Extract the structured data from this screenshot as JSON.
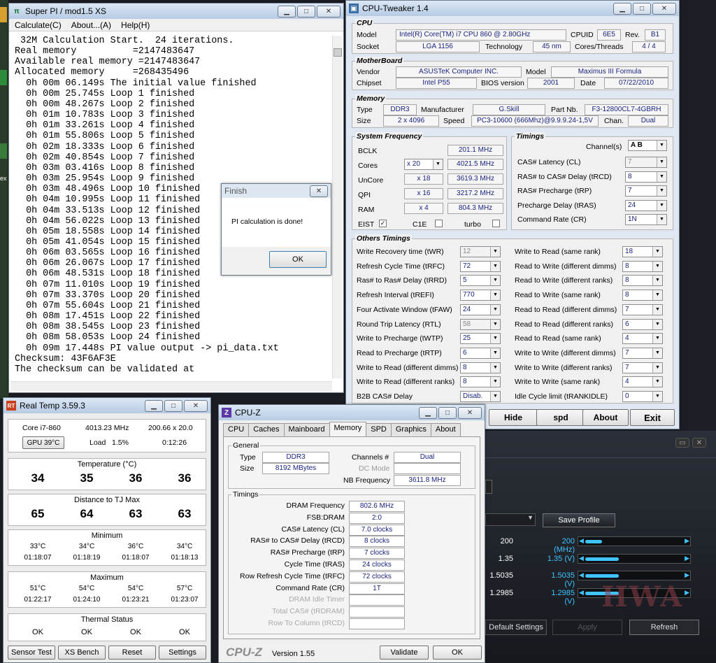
{
  "desktop": {
    "icon_label": "ex"
  },
  "superpi": {
    "title": "Super PI / mod1.5 XS",
    "menu": [
      "Calculate(C)",
      "About...(A)",
      "Help(H)"
    ],
    "lines": [
      " 32M Calculation Start.  24 iterations.",
      "Real memory          =2147483647",
      "Available real memory =2147483647",
      "Allocated memory     =268435496",
      "  0h 00m 06.149s The initial value finished",
      "  0h 00m 25.745s Loop 1 finished",
      "  0h 00m 48.267s Loop 2 finished",
      "  0h 01m 10.783s Loop 3 finished",
      "  0h 01m 33.261s Loop 4 finished",
      "  0h 01m 55.806s Loop 5 finished",
      "  0h 02m 18.333s Loop 6 finished",
      "  0h 02m 40.854s Loop 7 finished",
      "  0h 03m 03.416s Loop 8 finished",
      "  0h 03m 25.954s Loop 9 finished",
      "  0h 03m 48.496s Loop 10 finished",
      "  0h 04m 10.995s Loop 11 finished",
      "  0h 04m 33.513s Loop 12 finished",
      "  0h 04m 56.022s Loop 13 finished",
      "  0h 05m 18.558s Loop 14 finished",
      "  0h 05m 41.054s Loop 15 finished",
      "  0h 06m 03.565s Loop 16 finished",
      "  0h 06m 26.067s Loop 17 finished",
      "  0h 06m 48.531s Loop 18 finished",
      "  0h 07m 11.010s Loop 19 finished",
      "  0h 07m 33.370s Loop 20 finished",
      "  0h 07m 55.604s Loop 21 finished",
      "  0h 08m 17.451s Loop 22 finished",
      "  0h 08m 38.545s Loop 23 finished",
      "  0h 08m 58.053s Loop 24 finished",
      "  0h 09m 17.448s PI value output -> pi_data.txt",
      "",
      "Checksum: 43F6AF3E",
      "The checksum can be validated at"
    ]
  },
  "finish": {
    "title": "Finish",
    "message": "PI calculation is done!",
    "ok": "OK"
  },
  "tweaker": {
    "title": "CPU-Tweaker 1.4",
    "cpu": {
      "section": "CPU",
      "model_label": "Model",
      "model": "Intel(R) Core(TM) i7 CPU        860  @ 2.80GHz",
      "cpuid_label": "CPUID",
      "cpuid": "6E5",
      "rev_label": "Rev.",
      "rev": "B1",
      "socket_label": "Socket",
      "socket": "LGA 1156",
      "tech_label": "Technology",
      "tech": "45 nm",
      "cores_label": "Cores/Threads",
      "cores": "4 / 4"
    },
    "mb": {
      "section": "MotherBoard",
      "vendor_label": "Vendor",
      "vendor": "ASUSTeK Computer INC.",
      "model_label": "Model",
      "model": "Maximus III Formula",
      "chipset_label": "Chipset",
      "chipset": "Intel P55",
      "bios_label": "BIOS version",
      "bios": "2001",
      "date_label": "Date",
      "date": "07/22/2010"
    },
    "mem": {
      "section": "Memory",
      "type_label": "Type",
      "type": "DDR3",
      "manu_label": "Manufacturer",
      "manu": "G.Skill",
      "part_label": "Part Nb.",
      "part": "F3-12800CL7-4GBRH",
      "size_label": "Size",
      "size": "2 x 4096",
      "speed_label": "Speed",
      "speed": "PC3-10600 (666Mhz)@9.9.9.24-1,5V",
      "chan_label": "Chan.",
      "chan": "Dual"
    },
    "sysfreq": {
      "section": "System Frequency",
      "bclk_label": "BCLK",
      "bclk": "201.1 MHz",
      "cores_label": "Cores",
      "cores_mult": "x 20",
      "cores_freq": "4021.5 MHz",
      "uncore_label": "UnCore",
      "uncore_mult": "x 18",
      "uncore_freq": "3619.3 MHz",
      "qpi_label": "QPI",
      "qpi_mult": "x 16",
      "qpi_freq": "3217.2 MHz",
      "ram_label": "RAM",
      "ram_mult": "x 4",
      "ram_freq": "804.3 MHz",
      "eist_label": "EIST",
      "c1e_label": "C1E",
      "turbo_label": "turbo",
      "eist_check": "✓"
    },
    "timings": {
      "section": "Timings",
      "channels_label": "Channel(s)",
      "channels": "A  B",
      "rows": [
        {
          "label": "CAS# Latency (CL)",
          "value": "7"
        },
        {
          "label": "RAS# to CAS# Delay (tRCD)",
          "value": "8"
        },
        {
          "label": "RAS# Precharge (tRP)",
          "value": "7"
        },
        {
          "label": "Precharge Delay (tRAS)",
          "value": "24"
        },
        {
          "label": "Command Rate (CR)",
          "value": "1N"
        }
      ]
    },
    "others": {
      "section": "Others Timings",
      "left": [
        {
          "label": "Write Recovery time (tWR)",
          "value": "12"
        },
        {
          "label": "Refresh Cycle Time (tRFC)",
          "value": "72"
        },
        {
          "label": "Ras# to Ras# Delay (tRRD)",
          "value": "5"
        },
        {
          "label": "Refresh Interval (tREFI)",
          "value": "770"
        },
        {
          "label": "Four Activate Window (tFAW)",
          "value": "24"
        },
        {
          "label": "Round Trip Latency (RTL)",
          "value": "58"
        },
        {
          "label": "Write to Precharge (tWTP)",
          "value": "25"
        },
        {
          "label": "Read to Precharge (tRTP)",
          "value": "6"
        },
        {
          "label": "Write to Read (different dimms)",
          "value": "8"
        },
        {
          "label": "Write to Read (different ranks)",
          "value": "8"
        },
        {
          "label": "B2B CAS# Delay",
          "value": "Disab."
        }
      ],
      "right": [
        {
          "label": "Write to Read (same rank)",
          "value": "18"
        },
        {
          "label": "Read to Write (different dimms)",
          "value": "8"
        },
        {
          "label": "Read to Write (different ranks)",
          "value": "8"
        },
        {
          "label": "Read to Write (same rank)",
          "value": "8"
        },
        {
          "label": "Read to Read (different dimms)",
          "value": "7"
        },
        {
          "label": "Read to Read (different ranks)",
          "value": "6"
        },
        {
          "label": "Read to Read (same rank)",
          "value": "4"
        },
        {
          "label": "Write to Write (different dimms)",
          "value": "7"
        },
        {
          "label": "Write to Write (different ranks)",
          "value": "7"
        },
        {
          "label": "Write to Write (same rank)",
          "value": "4"
        },
        {
          "label": "Idle Cycle limit (tRANKIDLE)",
          "value": "0"
        }
      ]
    },
    "buttons": {
      "hide": "Hide",
      "spd": "spd",
      "about": "About",
      "exit": "Exit"
    }
  },
  "realtemp": {
    "title": "Real Temp 3.59.3",
    "cpu": "Core i7-860",
    "freq": "4013.23 MHz",
    "bclk": "200.66 x 20.0",
    "gpu": "GPU  39°C",
    "load_label": "Load",
    "load": "1.5%",
    "time": "0:12:26",
    "temp_label": "Temperature (°C)",
    "temps": [
      "34",
      "35",
      "36",
      "36"
    ],
    "dist_label": "Distance to TJ Max",
    "dist": [
      "65",
      "64",
      "63",
      "63"
    ],
    "min_label": "Minimum",
    "min": [
      {
        "t": "33°C",
        "at": "01:18:07"
      },
      {
        "t": "34°C",
        "at": "01:18:19"
      },
      {
        "t": "36°C",
        "at": "01:18:07"
      },
      {
        "t": "34°C",
        "at": "01:18:13"
      }
    ],
    "max_label": "Maximum",
    "max": [
      {
        "t": "51°C",
        "at": "01:22:17"
      },
      {
        "t": "54°C",
        "at": "01:24:10"
      },
      {
        "t": "54°C",
        "at": "01:23:21"
      },
      {
        "t": "57°C",
        "at": "01:23:07"
      }
    ],
    "thermal_label": "Thermal Status",
    "thermal": [
      "OK",
      "OK",
      "OK",
      "OK"
    ],
    "buttons": [
      "Sensor Test",
      "XS Bench",
      "Reset",
      "Settings"
    ]
  },
  "cpuz": {
    "title": "CPU-Z",
    "tabs": [
      "CPU",
      "Caches",
      "Mainboard",
      "Memory",
      "SPD",
      "Graphics",
      "About"
    ],
    "general_label": "General",
    "type_label": "Type",
    "type": "DDR3",
    "size_label": "Size",
    "size": "8192 MBytes",
    "channels_label": "Channels #",
    "channels": "Dual",
    "dc_label": "DC Mode",
    "nb_label": "NB Frequency",
    "nb": "3611.8 MHz",
    "timings_label": "Timings",
    "timings": [
      {
        "label": "DRAM Frequency",
        "value": "802.6 MHz"
      },
      {
        "label": "FSB:DRAM",
        "value": "2:0"
      },
      {
        "label": "CAS# Latency (CL)",
        "value": "7.0 clocks"
      },
      {
        "label": "RAS# to CAS# Delay (tRCD)",
        "value": "8 clocks"
      },
      {
        "label": "RAS# Precharge (tRP)",
        "value": "7 clocks"
      },
      {
        "label": "Cycle Time (tRAS)",
        "value": "24 clocks"
      },
      {
        "label": "Row Refresh Cycle Time (tRFC)",
        "value": "72 clocks"
      },
      {
        "label": "Command Rate (CR)",
        "value": "1T"
      },
      {
        "label": "DRAM Idle Timer",
        "value": ""
      },
      {
        "label": "Total CAS# (tRDRAM)",
        "value": ""
      },
      {
        "label": "Row To Column (tRCD)",
        "value": ""
      }
    ],
    "brand": "CPU-Z",
    "version": "Version 1.55",
    "validate": "Validate",
    "ok": "OK"
  },
  "dark": {
    "save_profile": "Save Profile",
    "rows": [
      {
        "a": "200",
        "b": "200 (MHz)",
        "pct": 0.15
      },
      {
        "a": "1.35",
        "b": "1.35 (V)",
        "pct": 0.3
      },
      {
        "a": "1.5035",
        "b": "1.5035 (V)",
        "pct": 0.3
      },
      {
        "a": "1.2985",
        "b": "1.2985 (V)",
        "pct": 0.3
      }
    ],
    "default": "Default Settings",
    "apply": "Apply",
    "refresh": "Refresh",
    "watermark": "HWA"
  }
}
